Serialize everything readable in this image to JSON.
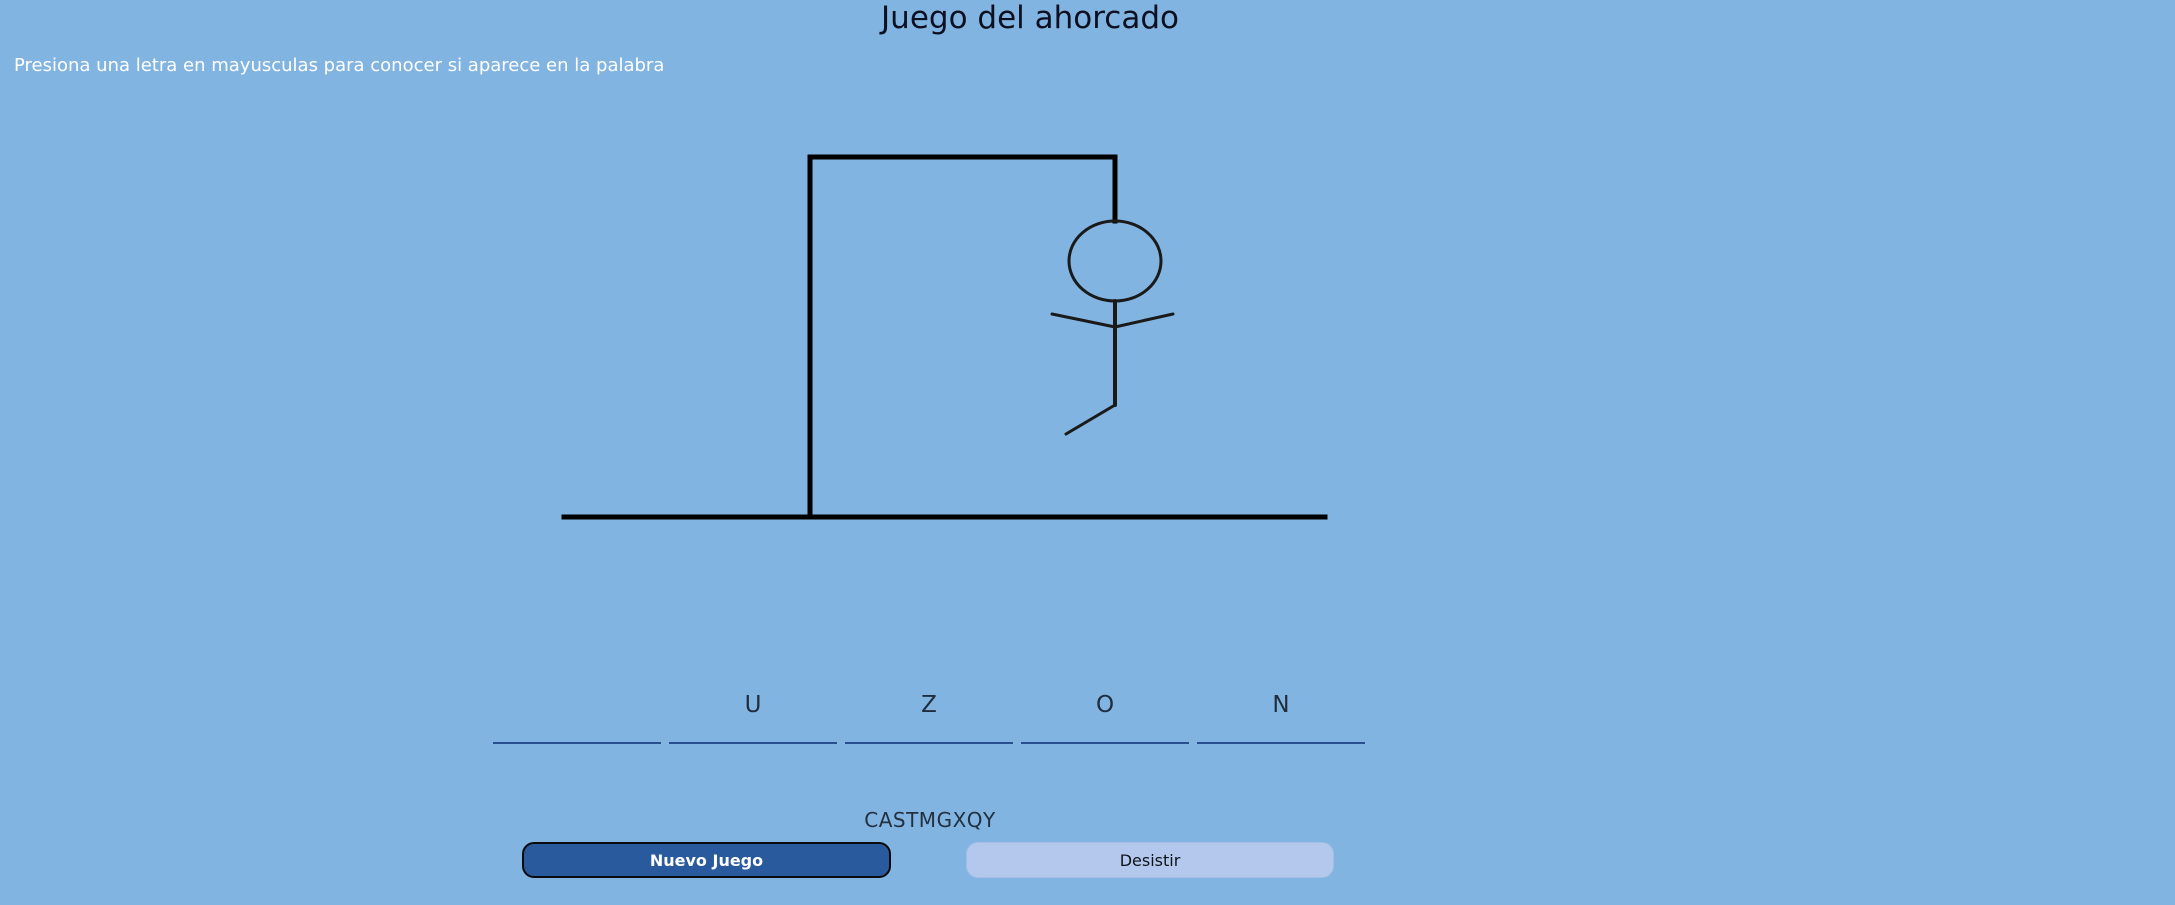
{
  "header": {
    "title": "Juego del ahorcado",
    "instructions": "Presiona una letra en mayusculas para conocer si aparece en la palabra"
  },
  "word_slots": [
    "",
    "U",
    "Z",
    "O",
    "N"
  ],
  "wrong_letters": "CASTMGXQY",
  "buttons": {
    "new_game": "Nuevo Juego",
    "give_up": "Desistir"
  },
  "colors": {
    "background": "#82b4e1",
    "new_game_button": "#2a5a9e",
    "give_up_button": "#b3c8ec"
  },
  "hangman": {
    "parts_drawn": [
      "gallows",
      "head",
      "body",
      "left-arm",
      "right-arm",
      "left-leg"
    ]
  }
}
